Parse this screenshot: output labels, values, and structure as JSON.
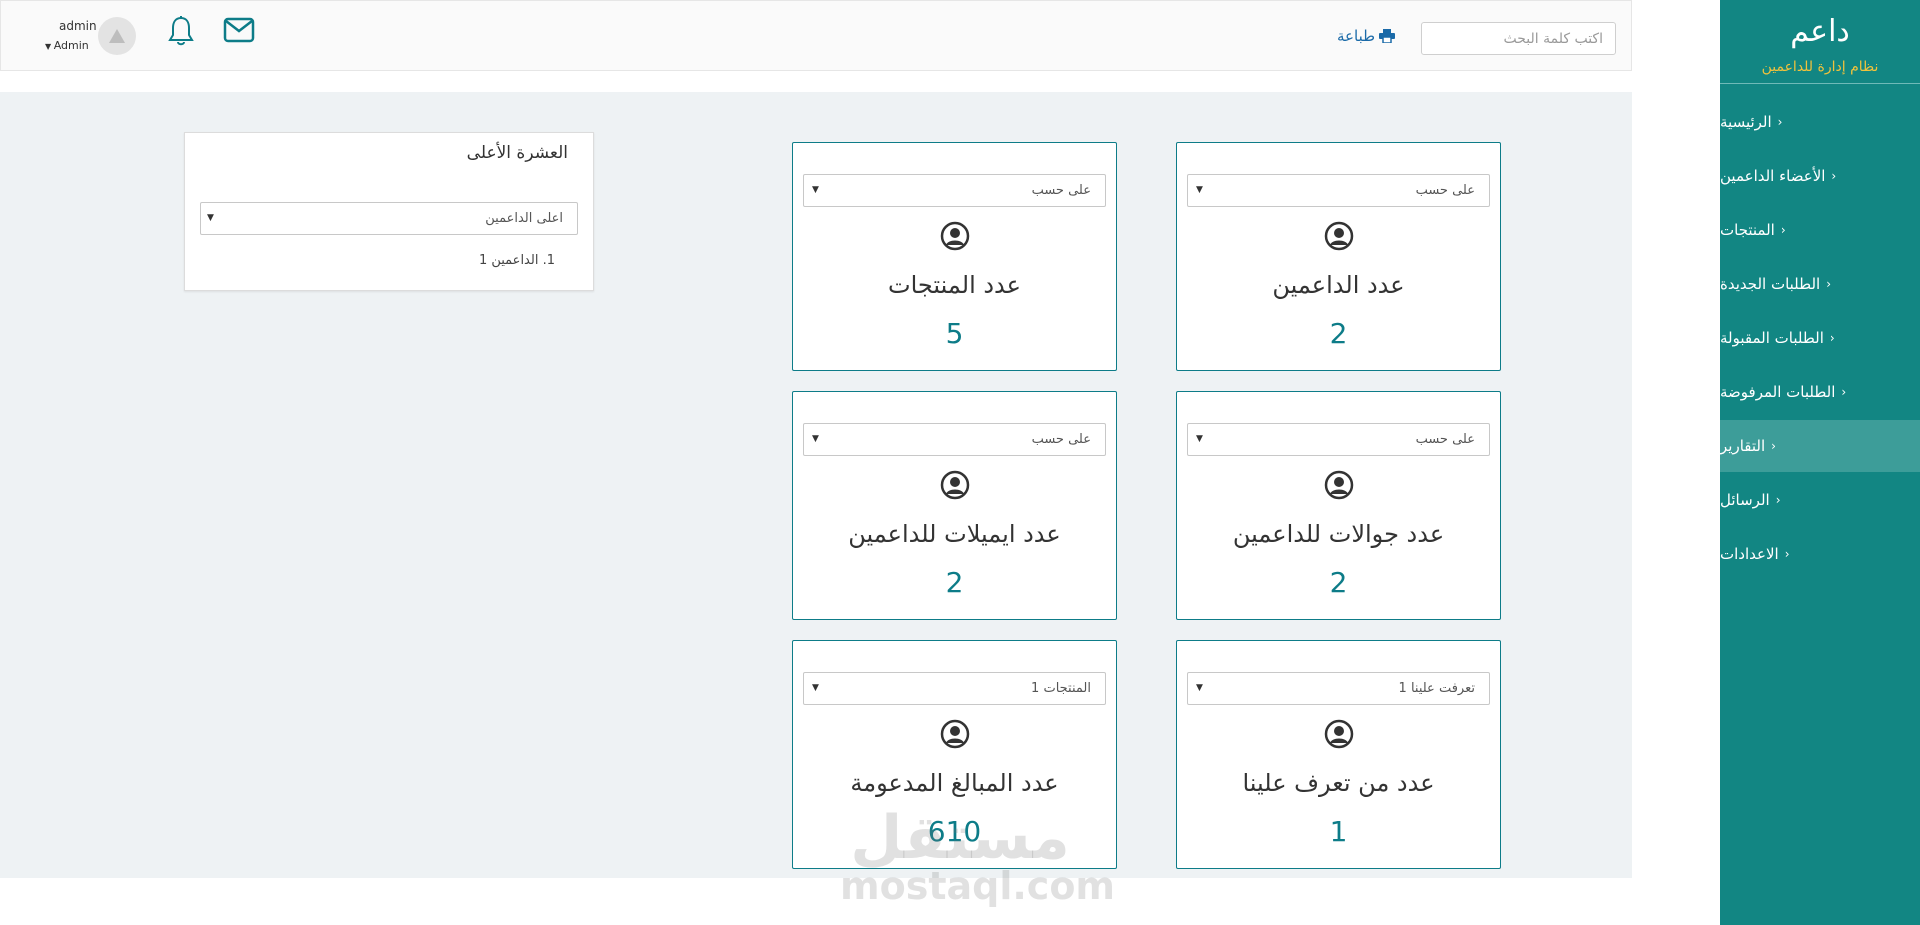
{
  "sidebar": {
    "brand_title": "داعم",
    "brand_subtitle": "نظام إدارة للداعمين",
    "items": [
      {
        "label": "الرئيسية",
        "active": false
      },
      {
        "label": "الأعضاء الداعمين",
        "active": false
      },
      {
        "label": "المنتجات",
        "active": false
      },
      {
        "label": "الطلبات الجديدة",
        "active": false
      },
      {
        "label": "الطلبات المقبولة",
        "active": false
      },
      {
        "label": "الطلبات المرفوضة",
        "active": false
      },
      {
        "label": "التقارير",
        "active": true
      },
      {
        "label": "الرسائل",
        "active": false
      },
      {
        "label": "الاعدادات",
        "active": false
      }
    ]
  },
  "header": {
    "search_placeholder": "اكتب كلمة البحث",
    "print_label": "طباعة",
    "user_name": "admin",
    "user_role": "Admin"
  },
  "cards": [
    {
      "select": "على حسب",
      "title": "عدد الداعمين",
      "value": "2"
    },
    {
      "select": "على حسب",
      "title": "عدد المنتجات",
      "value": "5"
    },
    {
      "select": "على حسب",
      "title": "عدد جوالات للداعمين",
      "value": "2"
    },
    {
      "select": "على حسب",
      "title": "عدد ايميلات للداعمين",
      "value": "2"
    },
    {
      "select": "تعرفت علينا 1",
      "title": "عدد من تعرف علينا",
      "value": "1"
    },
    {
      "select": "المنتجات 1",
      "title": "عدد المبالغ المدعومة",
      "value": "610"
    }
  ],
  "top_ten": {
    "title": "العشرة الأعلى",
    "select": "اعلى الداعمين",
    "item": "1. الداعمين 1"
  },
  "watermark": {
    "logo": "مستقل",
    "url": "mostaql.com"
  },
  "colors": {
    "sidebar_bg": "#128683",
    "accent": "#0d7c88",
    "brand_subtitle": "#f0c23c",
    "content_bg": "#eef2f4"
  }
}
